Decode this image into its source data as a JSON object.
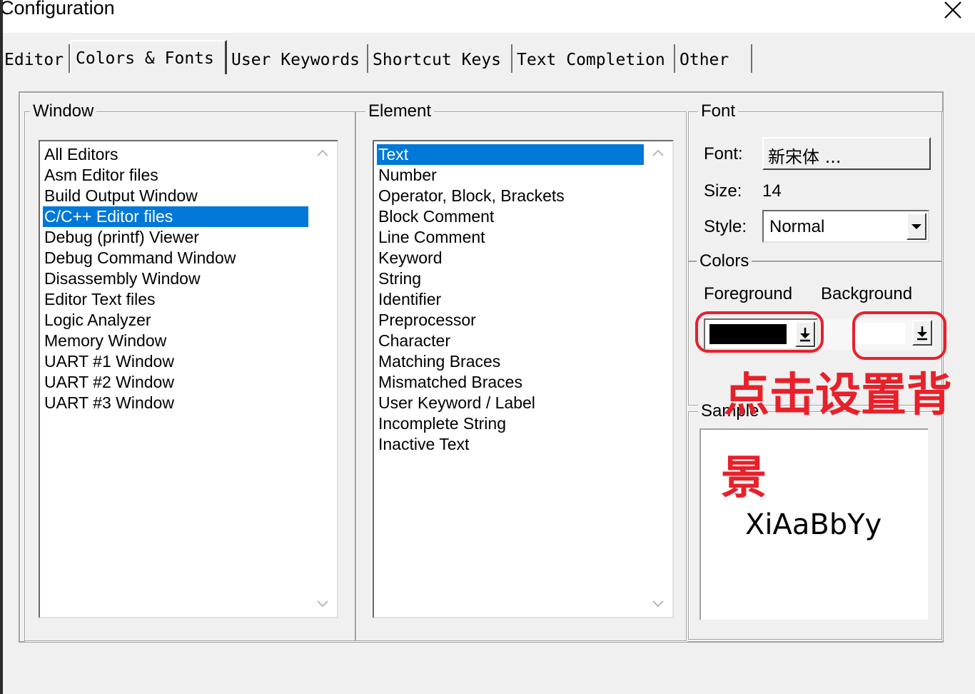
{
  "window": {
    "title": "Configuration",
    "close_glyph": "✕"
  },
  "tabs": [
    {
      "label": "Editor",
      "active": false
    },
    {
      "label": "Colors & Fonts",
      "active": true
    },
    {
      "label": "User Keywords",
      "active": false
    },
    {
      "label": "Shortcut Keys",
      "active": false
    },
    {
      "label": "Text Completion",
      "active": false
    },
    {
      "label": "Other",
      "active": false
    }
  ],
  "window_group": {
    "legend": "Window",
    "items": [
      "All Editors",
      "Asm Editor files",
      "Build Output Window",
      "C/C++ Editor files",
      "Debug (printf) Viewer",
      "Debug Command Window",
      "Disassembly Window",
      "Editor Text files",
      "Logic Analyzer",
      "Memory Window",
      "UART #1 Window",
      "UART #2 Window",
      "UART #3 Window"
    ],
    "selected": "C/C++ Editor files"
  },
  "element_group": {
    "legend": "Element",
    "items": [
      "Text",
      "Number",
      "Operator, Block, Brackets",
      "Block Comment",
      "Line Comment",
      "Keyword",
      "String",
      "Identifier",
      "Preprocessor",
      "Character",
      "Matching Braces",
      "Mismatched Braces",
      "User Keyword / Label",
      "Incomplete String",
      "Inactive Text"
    ],
    "selected": "Text"
  },
  "font_group": {
    "legend": "Font",
    "font_label": "Font:",
    "font_value": "新宋体 ...",
    "size_label": "Size:",
    "size_value": "14",
    "style_label": "Style:",
    "style_value": "Normal"
  },
  "colors_group": {
    "legend": "Colors",
    "foreground_label": "Foreground",
    "background_label": "Background",
    "foreground_color": "#000000",
    "background_color": "#ffffff"
  },
  "sample_group": {
    "legend": "Sample",
    "sample_text": "XiAaBbYy"
  },
  "annotation": {
    "text_line1": "点击设置背",
    "text_line2": "景",
    "color": "#e8202a"
  },
  "icons": {
    "scroll_up": "chevron-up-icon",
    "scroll_down": "chevron-down-icon",
    "dropdown": "down-arrow-icon"
  }
}
